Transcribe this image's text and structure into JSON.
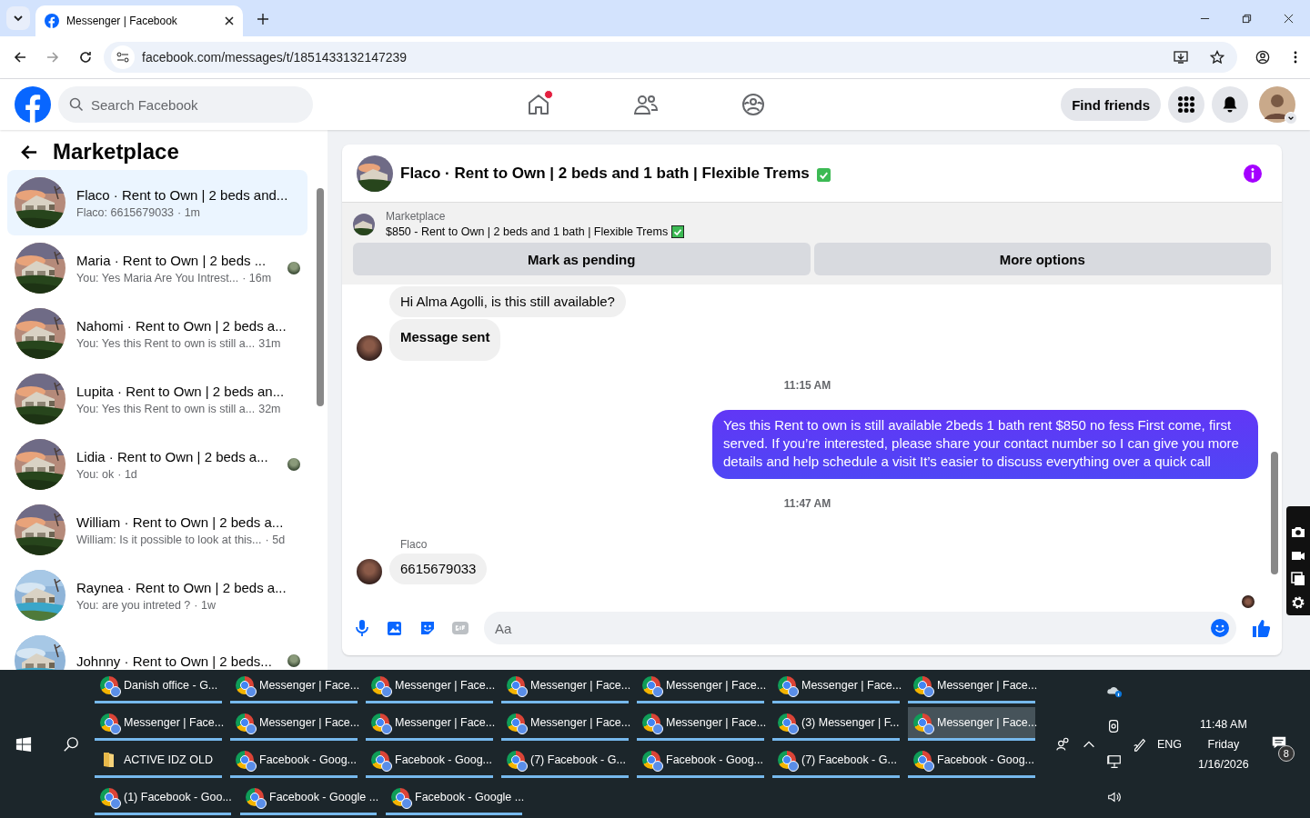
{
  "browser": {
    "tab_title": "Messenger | Facebook",
    "url": "facebook.com/messages/t/1851433132147239"
  },
  "facebook_bar": {
    "search_placeholder": "Search Facebook",
    "home_notification": true,
    "find_friends": "Find friends"
  },
  "sidebar": {
    "title": "Marketplace",
    "conversations": [
      {
        "title": "Flaco · Rent to Own | 2 beds and...",
        "preview": "Flaco: 6615679033",
        "time": "· 1m",
        "selected": true,
        "seen": false
      },
      {
        "title": "Maria · Rent to Own | 2 beds ...",
        "preview": "You: Yes Maria Are You Intrest...",
        "time": "· 16m",
        "selected": false,
        "seen": true
      },
      {
        "title": "Nahomi · Rent to Own | 2 beds a...",
        "preview": "You: Yes this Rent to own is still a...",
        "time": "31m",
        "selected": false,
        "seen": false
      },
      {
        "title": "Lupita · Rent to Own | 2 beds an...",
        "preview": "You: Yes this Rent to own is still a...",
        "time": "32m",
        "selected": false,
        "seen": false
      },
      {
        "title": "Lidia · Rent to Own | 2 beds a...",
        "preview": "You: ok",
        "time": "· 1d",
        "selected": false,
        "seen": true
      },
      {
        "title": "William · Rent to Own | 2 beds a...",
        "preview": "William: Is it possible to look at this...",
        "time": "· 5d",
        "selected": false,
        "seen": false
      },
      {
        "title": "Raynea · Rent to Own | 2 beds a...",
        "preview": "You: are you intreted ?",
        "time": "· 1w",
        "selected": false,
        "seen": false
      },
      {
        "title": "Johnny · Rent to Own | 2 beds...",
        "selected": false,
        "seen": true
      }
    ]
  },
  "chat": {
    "title": "Flaco · Rent to Own | 2 beds and 1 bath | Flexible Trems",
    "listing": {
      "label": "Marketplace",
      "title": "$850 - Rent to Own | 2 beds and 1 bath | Flexible Trems"
    },
    "actions": [
      "Mark as pending",
      "More options"
    ],
    "messages": [
      {
        "kind": "incoming",
        "text": "Hi Alma Agolli, is this still available?",
        "avatar": false,
        "bold": false
      },
      {
        "kind": "incoming",
        "text": "Message sent",
        "avatar": true,
        "bold": true
      },
      {
        "kind": "time",
        "text": "11:15 AM"
      },
      {
        "kind": "outgoing",
        "text": "Yes this Rent to own is still available 2beds 1 bath rent $850 no fess First come, first served. If you’re interested, please share your contact number so I can give you more details and help schedule a visit It’s easier to discuss everything over a quick call"
      },
      {
        "kind": "time",
        "text": "11:47 AM"
      },
      {
        "kind": "sender",
        "text": "Flaco"
      },
      {
        "kind": "incoming",
        "text": "6615679033",
        "avatar": true,
        "bold": false
      }
    ],
    "composer": {
      "placeholder": "Aa"
    }
  },
  "taskbar": {
    "rows": [
      [
        {
          "label": "Danish office - G...",
          "kind": "chrome",
          "selected": false
        },
        {
          "label": "Messenger | Face...",
          "kind": "chrome",
          "selected": false
        },
        {
          "label": "Messenger | Face...",
          "kind": "chrome",
          "selected": false
        },
        {
          "label": "Messenger | Face...",
          "kind": "chrome",
          "selected": false
        },
        {
          "label": "Messenger | Face...",
          "kind": "chrome",
          "selected": false
        },
        {
          "label": "Messenger | Face...",
          "kind": "chrome",
          "selected": false
        },
        {
          "label": "Messenger | Face...",
          "kind": "chrome",
          "selected": false
        }
      ],
      [
        {
          "label": "Messenger | Face...",
          "kind": "chrome",
          "selected": false
        },
        {
          "label": "Messenger | Face...",
          "kind": "chrome",
          "selected": false
        },
        {
          "label": "Messenger | Face...",
          "kind": "chrome",
          "selected": false
        },
        {
          "label": "Messenger | Face...",
          "kind": "chrome",
          "selected": false
        },
        {
          "label": "Messenger | Face...",
          "kind": "chrome",
          "selected": false
        },
        {
          "label": "(3) Messenger | F...",
          "kind": "chrome",
          "selected": false
        },
        {
          "label": "Messenger | Face...",
          "kind": "chrome",
          "selected": true
        }
      ],
      [
        {
          "label": "ACTIVE IDZ OLD",
          "kind": "folder",
          "selected": false
        },
        {
          "label": "Facebook - Goog...",
          "kind": "chrome",
          "selected": false
        },
        {
          "label": "Facebook - Goog...",
          "kind": "chrome",
          "selected": false
        },
        {
          "label": "(7) Facebook - G...",
          "kind": "chrome",
          "selected": false
        },
        {
          "label": "Facebook - Goog...",
          "kind": "chrome",
          "selected": false
        },
        {
          "label": "(7) Facebook - G...",
          "kind": "chrome",
          "selected": false
        },
        {
          "label": "Facebook - Goog...",
          "kind": "chrome",
          "selected": false
        }
      ],
      [
        {
          "label": "(1) Facebook - Goo...",
          "kind": "chrome",
          "selected": false
        },
        {
          "label": "Facebook - Google ...",
          "kind": "chrome",
          "selected": false
        },
        {
          "label": "Facebook - Google ...",
          "kind": "chrome",
          "selected": false
        }
      ]
    ],
    "tray": {
      "language": "ENG",
      "time": "11:48 AM",
      "day": "Friday",
      "date": "1/16/2026",
      "notifications": "8"
    }
  }
}
